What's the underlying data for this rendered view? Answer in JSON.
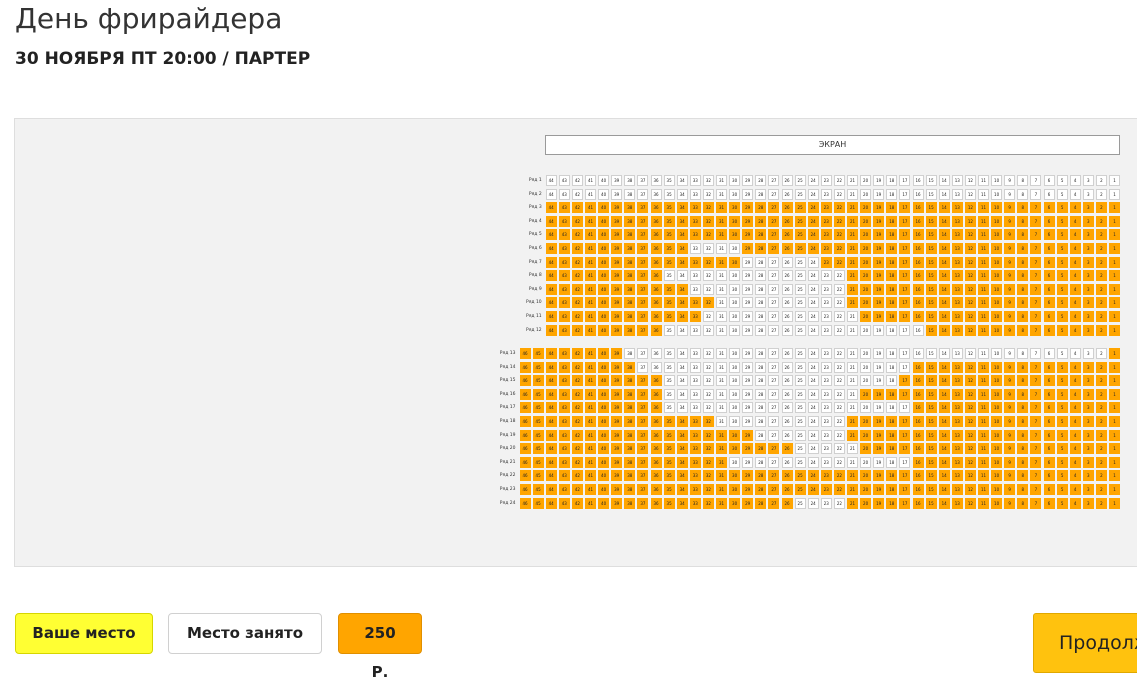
{
  "header": {
    "title": "День фрирайдера",
    "subtitle": "30 НОЯБРЯ ПТ 20:00 / ПАРТЕР"
  },
  "hall": {
    "screen_label": "ЭКРАН",
    "row_prefix": "Ряд",
    "block_a": {
      "row_start": 1,
      "row_end": 12,
      "seat_max": 44
    },
    "block_b": {
      "row_start": 13,
      "row_end": 24,
      "seat_max": 46
    },
    "taken": {
      "1": [
        1,
        44
      ],
      "2": [
        1,
        44
      ],
      "6": [
        30,
        33
      ],
      "7": [
        24,
        29
      ],
      "8": [
        22,
        35
      ],
      "9": [
        22,
        33
      ],
      "10": [
        22,
        31
      ],
      "11": [
        21,
        32
      ],
      "12": [
        16,
        35
      ],
      "13": [
        2,
        38
      ],
      "14": [
        17,
        37
      ],
      "15": [
        18,
        35
      ],
      "16": [
        21,
        35
      ],
      "17": [
        17,
        35
      ],
      "18": [
        22,
        31
      ],
      "19": [
        22,
        28
      ],
      "20": [
        21,
        25
      ],
      "21": [
        17,
        30
      ],
      "24": [
        22,
        25
      ]
    }
  },
  "legend": {
    "yours_label": "Ваше место",
    "taken_label": "Место занято",
    "price_label": "250 Р."
  },
  "actions": {
    "continue_label": "Продолжить"
  },
  "colors": {
    "seat_free": "#ffa500",
    "seat_taken": "#ffffff",
    "your_seat": "#ffff33",
    "continue_button": "#ffc20e"
  }
}
